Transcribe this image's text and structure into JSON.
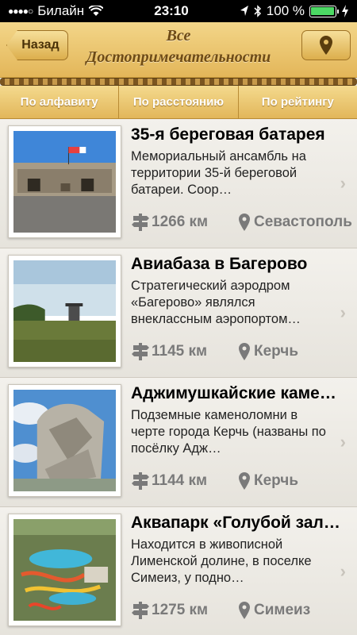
{
  "status": {
    "carrier": "Билайн",
    "time": "23:10",
    "battery": "100 %"
  },
  "nav": {
    "back_label": "Назад",
    "title_line1": "Все",
    "title_line2": "Достопримечательности"
  },
  "segments": [
    "По алфавиту",
    "По расстоянию",
    "По рейтингу"
  ],
  "items": [
    {
      "title": "35-я береговая батарея",
      "desc": "Мемориальный ансамбль на территории 35-й береговой батареи. Соор…",
      "distance": "1266 км",
      "city": "Севастополь"
    },
    {
      "title": "Авиабаза в Багерово",
      "desc": "Стратегический аэродром «Багерово» являлся внеклассным аэропортом…",
      "distance": "1145 км",
      "city": "Керчь"
    },
    {
      "title": "Аджимушкайские каме…",
      "desc": "Подземные каменоломни в черте города Керчь (названы по посёлку Адж…",
      "distance": "1144 км",
      "city": "Керчь"
    },
    {
      "title": "Аквапарк «Голубой зал…",
      "desc": "Находится в живописной Лименской долине, в поселке Симеиз, у подно…",
      "distance": "1275 км",
      "city": "Симеиз"
    }
  ]
}
